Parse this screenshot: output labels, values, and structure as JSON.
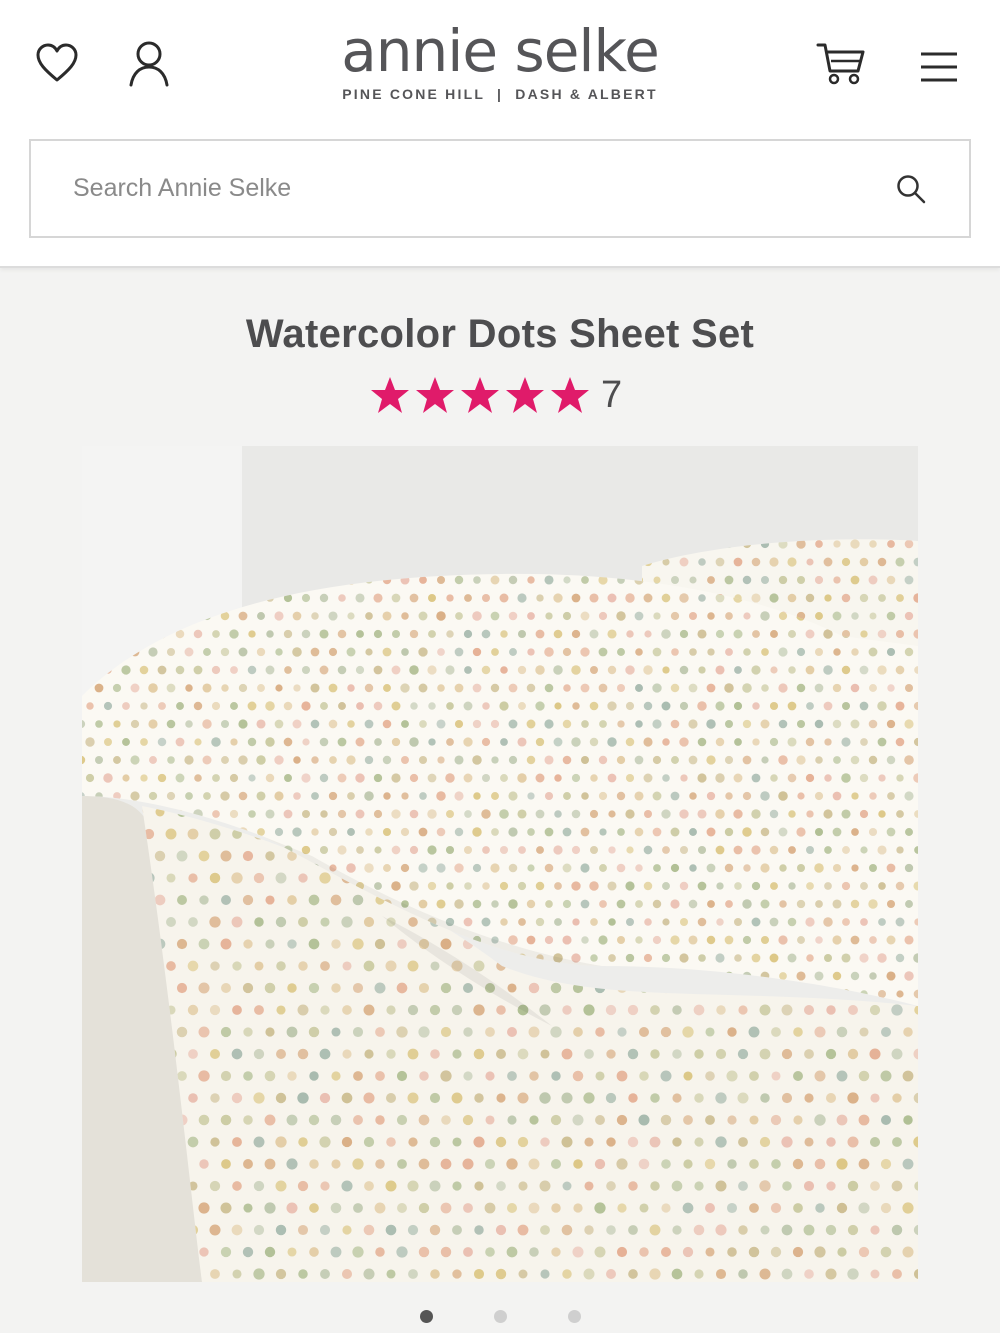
{
  "brand": {
    "name": "annie selke",
    "sub_brands": "PINE CONE HILL  |  DASH & ALBERT"
  },
  "header": {
    "icons": [
      "heart-icon",
      "user-icon",
      "cart-icon",
      "hamburger-menu-icon"
    ]
  },
  "search": {
    "placeholder": "Search Annie Selke",
    "icon": "search-icon"
  },
  "product": {
    "title": "Watercolor Dots Sheet Set",
    "rating": 5,
    "rating_max": 5,
    "review_count": "7",
    "star_color": "#e01b6a",
    "image_alt": "Watercolor Dots Sheet Set on bed with pillows"
  },
  "carousel": {
    "slides": 3,
    "active_index": 0
  },
  "colors": {
    "accent": "#e01b6a",
    "text": "#4d4d4f",
    "background": "#f3f3f2"
  }
}
